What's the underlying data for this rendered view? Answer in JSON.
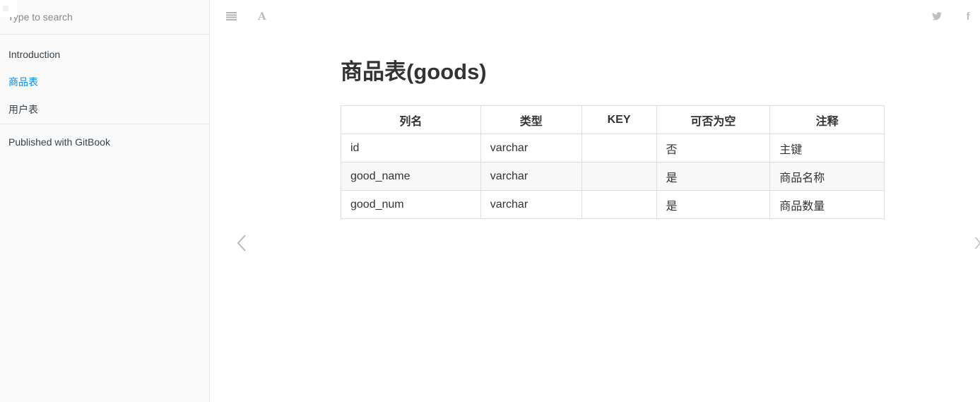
{
  "sidebar": {
    "search_placeholder": "Type to search",
    "items": [
      {
        "label": "Introduction",
        "active": false
      },
      {
        "label": "商品表",
        "active": true
      },
      {
        "label": "用户表",
        "active": false
      }
    ],
    "published_label": "Published with GitBook"
  },
  "toolbar": {
    "icons": [
      "menu-icon",
      "font-settings-icon",
      "twitter-icon",
      "facebook-icon"
    ],
    "font_glyph": "A",
    "facebook_glyph": "f"
  },
  "page": {
    "title": "商品表(goods)"
  },
  "table": {
    "headers": [
      "列名",
      "类型",
      "KEY",
      "可否为空",
      "注释"
    ],
    "rows": [
      [
        "id",
        "varchar",
        "",
        "否",
        "主键"
      ],
      [
        "good_name",
        "varchar",
        "",
        "是",
        "商品名称"
      ],
      [
        "good_num",
        "varchar",
        "",
        "是",
        "商品数量"
      ]
    ]
  },
  "colors": {
    "accent": "#008cff",
    "sidebar_bg": "#fafafa",
    "border": "#dddddd",
    "icon": "#b5b5b5"
  }
}
